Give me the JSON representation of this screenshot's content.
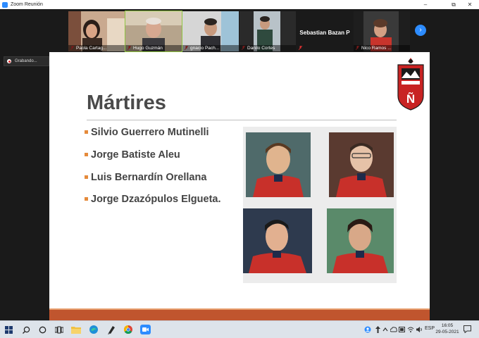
{
  "window": {
    "title": "Zoom Reunión",
    "controls": [
      "–",
      "⧉",
      "✕"
    ]
  },
  "participants": [
    {
      "name": "Paola Cartag...",
      "video": true,
      "active": false
    },
    {
      "name": "Hugo Guzmán",
      "video": true,
      "active": true
    },
    {
      "name": "gnacio Pach...",
      "video": true,
      "active": false
    },
    {
      "name": "Danilo Cortes",
      "video": true,
      "active": false
    },
    {
      "name": "Sebastian Bazan P",
      "video": false,
      "active": false
    },
    {
      "name": "Nico Ramos ...",
      "video": true,
      "active": false
    }
  ],
  "recording": {
    "label": "Grabando..."
  },
  "next_icon": "chevron-right-icon",
  "slide": {
    "title": "Mártires",
    "bullets": [
      "Silvio Guerrero Mutinelli",
      "Jorge Batiste Aleu",
      "Luis Bernardín Orellana",
      "Jorge Dzazópulos Elgueta."
    ],
    "logo_letter": "Ñ",
    "colors": {
      "accent_band": "#c0552e",
      "bullet": "#e58a3b",
      "title": "#4a4a4a"
    }
  },
  "taskbar": {
    "apps": [
      "start-icon",
      "search-icon",
      "cortana-icon",
      "task-view-icon",
      "file-explorer-icon",
      "edge-icon",
      "pen-icon",
      "chrome-icon",
      "zoom-icon"
    ],
    "lang": "ESP",
    "time": "16:05",
    "date": "29-05-2021"
  }
}
